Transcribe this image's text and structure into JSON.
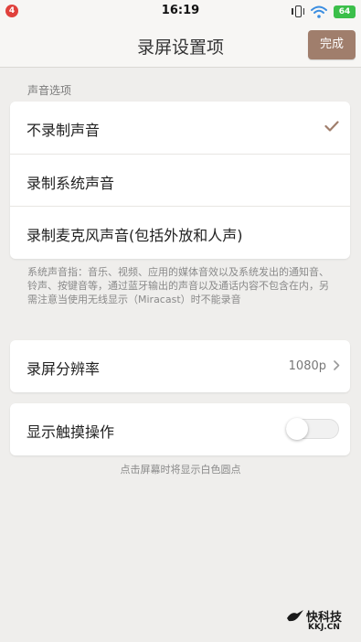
{
  "status_bar": {
    "notification_count": "4",
    "time": "16:19",
    "battery": "64"
  },
  "header": {
    "title": "录屏设置项",
    "done_label": "完成"
  },
  "sound_section": {
    "title": "声音选项",
    "options": [
      {
        "label": "不录制声音",
        "selected": true
      },
      {
        "label": "录制系统声音",
        "selected": false
      },
      {
        "label": "录制麦克风声音(包括外放和人声)",
        "selected": false
      }
    ],
    "note": "系统声音指：音乐、视频、应用的媒体音效以及系统发出的通知音、铃声、按键音等，通过蓝牙输出的声音以及通话内容不包含在内，另需注意当使用无线显示（Miracast）时不能录音"
  },
  "resolution": {
    "label": "录屏分辨率",
    "value": "1080p"
  },
  "touch": {
    "label": "显示触摸操作",
    "enabled": false,
    "note": "点击屏幕时将显示白色圆点"
  },
  "watermark": {
    "name": "快科技",
    "domain": "KKJ.CN"
  },
  "colors": {
    "accent": "#a07e6c",
    "background": "#efeeec",
    "card": "#ffffff",
    "battery": "#3bbf4a",
    "badge": "#e0413c"
  }
}
